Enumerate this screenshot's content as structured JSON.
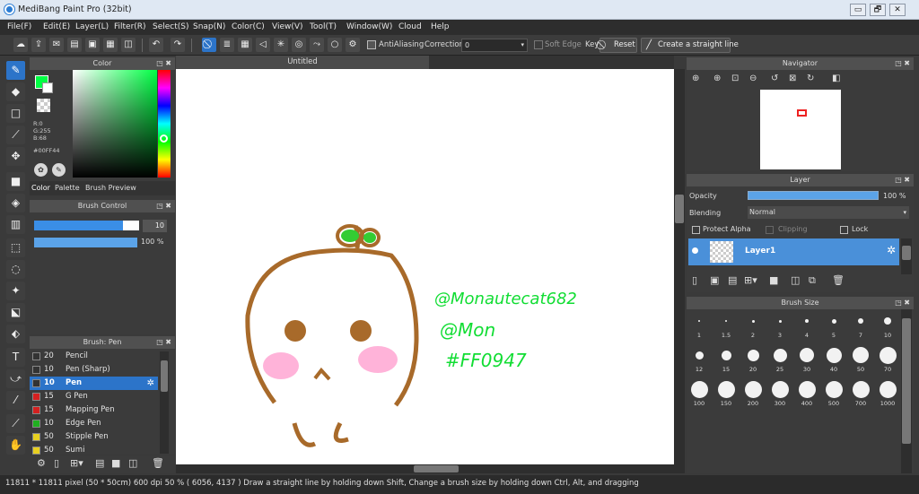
{
  "window": {
    "title": "MediBang Paint Pro (32bit)",
    "min": "▭",
    "restore": "🗗",
    "close": "✕"
  },
  "menu": [
    "File(F)",
    "Edit(E)",
    "Layer(L)",
    "Filter(R)",
    "Select(S)",
    "Snap(N)",
    "Color(C)",
    "View(V)",
    "Tool(T)",
    "Window(W)",
    "Cloud",
    "Help"
  ],
  "toolbar": {
    "antialiasing": "AntiAliasing",
    "correction_label": "Correction",
    "correction_value": "0",
    "soft_edge": "Soft Edge",
    "key": "Key",
    "reset": "Reset",
    "straight_line": "Create a straight line"
  },
  "color_panel": {
    "title": "Color",
    "r": "R:0",
    "g": "G:255",
    "b": "B:68",
    "hex": "#00FF44",
    "tabs": [
      "Color",
      "Palette",
      "Brush Preview"
    ],
    "current_color": "#00FF44"
  },
  "brush_control": {
    "title": "Brush Control",
    "size": "10",
    "opacity": "100 %",
    "opacity_fraction": 1.0,
    "size_fraction": 0.85
  },
  "brush_list": {
    "title": "Brush: Pen",
    "items": [
      {
        "size": "20",
        "name": "Pencil",
        "color": "#333333"
      },
      {
        "size": "10",
        "name": "Pen (Sharp)",
        "color": "#333333"
      },
      {
        "size": "10",
        "name": "Pen",
        "color": "#333333"
      },
      {
        "size": "15",
        "name": "G Pen",
        "color": "#d42020"
      },
      {
        "size": "15",
        "name": "Mapping Pen",
        "color": "#d42020"
      },
      {
        "size": "10",
        "name": "Edge Pen",
        "color": "#20b020"
      },
      {
        "size": "50",
        "name": "Stipple Pen",
        "color": "#e8d020"
      },
      {
        "size": "50",
        "name": "Sumi",
        "color": "#e8d020"
      }
    ]
  },
  "canvas": {
    "tab": "Untitled",
    "handles": [
      "@Monautecat682",
      "@Mon",
      "#FF0947"
    ]
  },
  "navigator": {
    "title": "Navigator"
  },
  "layer_panel": {
    "title": "Layer",
    "opacity_label": "Opacity",
    "opacity_value": "100 %",
    "blending_label": "Blending",
    "blending_value": "Normal",
    "protect_alpha": "Protect Alpha",
    "clipping": "Clipping",
    "lock": "Lock",
    "layer_name": "Layer1"
  },
  "brush_size": {
    "title": "Brush Size",
    "row1": [
      "1",
      "1.5",
      "2",
      "3",
      "4",
      "5",
      "7",
      "10"
    ],
    "row2": [
      "12",
      "15",
      "20",
      "25",
      "30",
      "40",
      "50",
      "70"
    ],
    "row3": [
      "100",
      "150",
      "200",
      "300",
      "400",
      "500",
      "700",
      "1000"
    ]
  },
  "status": "11811 * 11811 pixel  (50 * 50cm)  600 dpi  50 %  ( 6056, 4137 )  Draw a straight line by holding down Shift, Change a brush size by holding down Ctrl, Alt, and dragging"
}
